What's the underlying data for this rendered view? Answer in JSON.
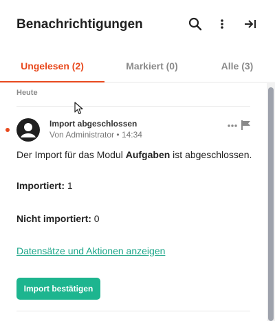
{
  "header": {
    "title": "Benachrichtigungen",
    "icons": [
      "search-icon",
      "more-vertical-icon",
      "collapse-panel-icon"
    ]
  },
  "tabs": [
    {
      "label": "Ungelesen (2)",
      "active": true
    },
    {
      "label": "Markiert (0)",
      "active": false
    },
    {
      "label": "Alle (3)",
      "active": false
    }
  ],
  "section": {
    "label": "Heute"
  },
  "notification": {
    "title": "Import abgeschlossen",
    "author": "Von Administrator",
    "separator": "•",
    "time": "14:34",
    "unread": true,
    "message_before": "Der Import für das Modul ",
    "message_module": "Aufgaben",
    "message_after": " ist abgeschlossen.",
    "imported_label": "Importiert:",
    "imported_value": "1",
    "not_imported_label": "Nicht importiert:",
    "not_imported_value": "0",
    "link_label": "Datensätze und Aktionen anzeigen",
    "confirm_label": "Import bestätigen"
  },
  "colors": {
    "accent": "#e8491d",
    "primary_button": "#1db58f",
    "link": "#1aa588",
    "scrollbar": "#9ea2ac"
  }
}
